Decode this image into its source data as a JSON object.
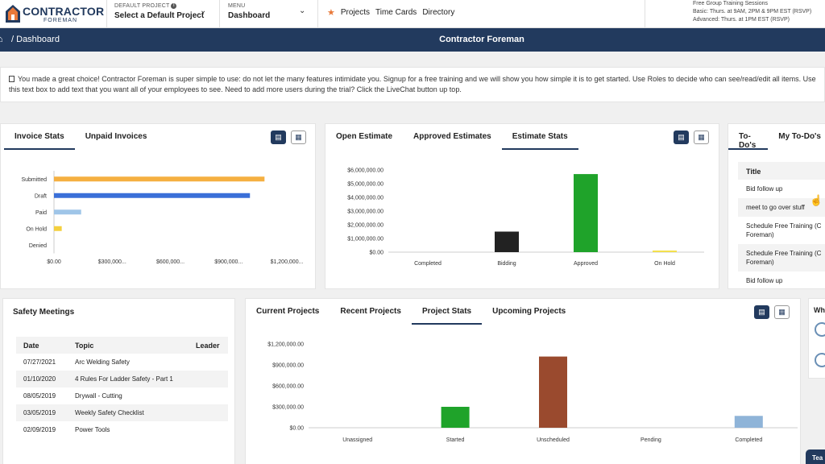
{
  "header": {
    "logo_main": "CONTRACTOR",
    "logo_sub": "FOREMAN",
    "default_project_label": "DEFAULT PROJECT",
    "default_project_value": "Select a Default Project",
    "menu_label": "MENU",
    "menu_value": "Dashboard",
    "quick_links": [
      "Projects",
      "Time Cards",
      "Directory"
    ],
    "training_lines": [
      "Free Group Training Sessions",
      "Basic: Thurs. at 9AM, 2PM & 9PM EST (RSVP)",
      "Advanced: Thurs. at 1PM EST (RSVP)"
    ]
  },
  "navbar": {
    "breadcrumb": "Dashboard",
    "title": "Contractor Foreman"
  },
  "notice": {
    "text": "You made a great choice! Contractor Foreman is super simple to use: do not let the many features intimidate you. Signup for a free training and we will show you how simple it is to get started. Use Roles to decide who can see/read/edit all items. Use this text box to add text that you want all of your employees to see. Need to add more users during the trial? Click the LiveChat button up top."
  },
  "invoice_panel": {
    "tabs": [
      "Invoice Stats",
      "Unpaid Invoices"
    ],
    "active_tab": 0
  },
  "estimate_panel": {
    "tabs": [
      "Open Estimate",
      "Approved Estimates",
      "Estimate Stats"
    ],
    "active_tab": 2
  },
  "todo_panel": {
    "tabs": [
      "To-Do's",
      "My To-Do's"
    ],
    "column": "Title",
    "items": [
      "Bid follow up",
      "meet to go over stuff",
      "Schedule Free Training (C\nForeman)",
      "Schedule Free Training (C\nForeman)",
      "Bid follow up"
    ]
  },
  "safety_panel": {
    "title": "Safety Meetings",
    "columns": [
      "Date",
      "Topic",
      "Leader"
    ],
    "rows": [
      [
        "07/27/2021",
        "Arc Welding Safety",
        ""
      ],
      [
        "01/10/2020",
        "4 Rules For Ladder Safety - Part 1",
        ""
      ],
      [
        "08/05/2019",
        "Drywall - Cutting",
        ""
      ],
      [
        "03/05/2019",
        "Weekly Safety Checklist",
        ""
      ],
      [
        "02/09/2019",
        "Power Tools",
        ""
      ]
    ]
  },
  "project_panel": {
    "tabs": [
      "Current Projects",
      "Recent Projects",
      "Project Stats",
      "Upcoming Projects"
    ],
    "active_tab": 2
  },
  "side_card": {
    "label": "Wh"
  },
  "chat_tab": {
    "label": "Tea"
  },
  "colors": {
    "navy": "#223a5e",
    "accent_orange": "#e8793a"
  },
  "chart_data": [
    {
      "id": "invoice-stats",
      "type": "bar",
      "orientation": "horizontal",
      "categories": [
        "Submitted",
        "Draft",
        "Paid",
        "On Hold",
        "Denied"
      ],
      "values": [
        1085000,
        1010000,
        140000,
        40000,
        0
      ],
      "colors": [
        "#f5b041",
        "#3a6fd8",
        "#9fc5e8",
        "#f4d03f",
        "#cccccc"
      ],
      "xlim": [
        0,
        1200000
      ],
      "x_ticks": [
        "$0.00",
        "$300,000...",
        "$600,000...",
        "$900,000...",
        "$1,200,000..."
      ]
    },
    {
      "id": "estimate-stats",
      "type": "bar",
      "categories": [
        "Completed",
        "Bidding",
        "Approved",
        "On Hold"
      ],
      "values": [
        0,
        1500000,
        5700000,
        100000
      ],
      "colors": [
        "#cccccc",
        "#222222",
        "#1fa32a",
        "#f4e04d"
      ],
      "ylim": [
        0,
        6000000
      ],
      "y_ticks": [
        "$0.00",
        "$1,000,000.00",
        "$2,000,000.00",
        "$3,000,000.00",
        "$4,000,000.00",
        "$5,000,000.00",
        "$6,000,000.00"
      ]
    },
    {
      "id": "project-stats",
      "type": "bar",
      "categories": [
        "Unassigned",
        "Started",
        "Unscheduled",
        "Pending",
        "Completed"
      ],
      "values": [
        0,
        300000,
        1020000,
        0,
        170000
      ],
      "colors": [
        "#cccccc",
        "#1fa32a",
        "#9a4a2e",
        "#cccccc",
        "#8fb4d8"
      ],
      "ylim": [
        0,
        1200000
      ],
      "y_ticks": [
        "$0.00",
        "$300,000.00",
        "$600,000.00",
        "$900,000.00",
        "$1,200,000.00"
      ]
    }
  ]
}
